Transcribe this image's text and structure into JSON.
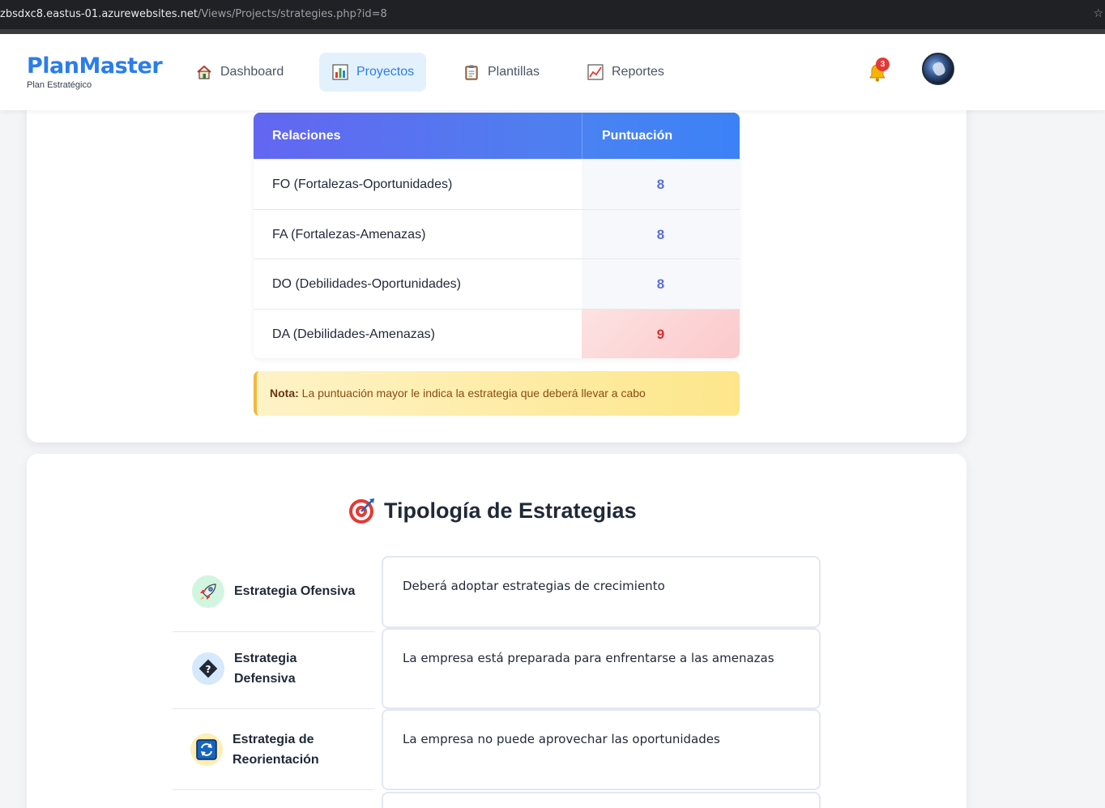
{
  "browser": {
    "url_host": "zbsdxc8.eastus-01.azurewebsites.net",
    "url_path": "/Views/Projects/strategies.php?id=8"
  },
  "brand": {
    "title": "PlanMaster",
    "subtitle": "Plan Estratégico"
  },
  "nav": {
    "items": [
      {
        "label": "Dashboard",
        "icon": "house-icon"
      },
      {
        "label": "Proyectos",
        "icon": "bar-chart-icon",
        "active": true
      },
      {
        "label": "Plantillas",
        "icon": "clipboard-icon"
      },
      {
        "label": "Reportes",
        "icon": "line-chart-icon"
      }
    ],
    "notifications": "3",
    "accent": "#2b7de9"
  },
  "score_table": {
    "headers": {
      "relations": "Relaciones",
      "score": "Puntuación"
    },
    "rows": [
      {
        "relation": "FO (Fortalezas-Oportunidades)",
        "score": "8"
      },
      {
        "relation": "FA (Fortalezas-Amenazas)",
        "score": "8"
      },
      {
        "relation": "DO (Debilidades-Oportunidades)",
        "score": "8"
      },
      {
        "relation": "DA (Debilidades-Amenazas)",
        "score": "9",
        "highlight": true
      }
    ]
  },
  "note": {
    "label": "Nota:",
    "text": "La puntuación mayor le indica la estrategia que deberá llevar a cabo"
  },
  "typology": {
    "title": "Tipología de Estrategias",
    "items": [
      {
        "line1": "Estrategia Ofensiva",
        "line2": "",
        "icon": "rocket-icon",
        "description": "Deberá adoptar estrategias de crecimiento"
      },
      {
        "line1": "Estrategia",
        "line2": "Defensiva",
        "icon": "shield-diamond-icon",
        "description": "La empresa está preparada para enfrentarse a las amenazas"
      },
      {
        "line1": "Estrategia de",
        "line2": "Reorientación",
        "icon": "refresh-icon",
        "description": "La empresa no puede aprovechar las oportunidades"
      }
    ]
  }
}
